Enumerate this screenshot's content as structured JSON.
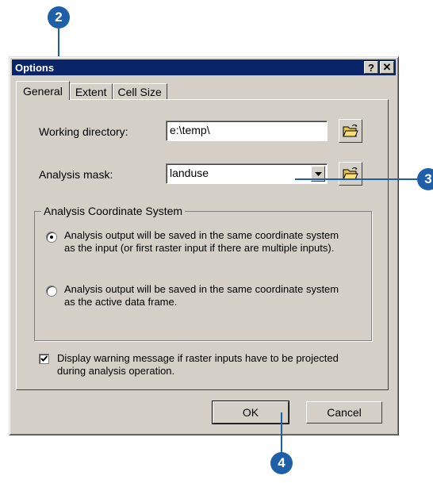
{
  "callouts": [
    "2",
    "3",
    "4"
  ],
  "dialog": {
    "title": "Options",
    "help_label": "?",
    "close_label": "✕"
  },
  "tabs": [
    {
      "label": "General",
      "active": true
    },
    {
      "label": "Extent",
      "active": false
    },
    {
      "label": "Cell Size",
      "active": false
    }
  ],
  "general": {
    "working_directory_label": "Working directory:",
    "working_directory_value": "e:\\temp\\",
    "analysis_mask_label": "Analysis mask:",
    "analysis_mask_value": "landuse",
    "coord_group_title": "Analysis Coordinate System",
    "radio_input": {
      "label": "Analysis output will be saved in the same coordinate system as the input (or first raster input if there are multiple inputs).",
      "checked": true
    },
    "radio_frame": {
      "label": "Analysis output will be saved in the same coordinate system as the active data frame.",
      "checked": false
    },
    "warning_checkbox": {
      "label": "Display warning message if raster inputs have to be projected during analysis operation.",
      "checked": true
    }
  },
  "buttons": {
    "ok": "OK",
    "cancel": "Cancel"
  },
  "colors": {
    "callout": "#1f5fa8",
    "titlebar": "#0a246a",
    "dialog_face": "#d4d0c8"
  }
}
